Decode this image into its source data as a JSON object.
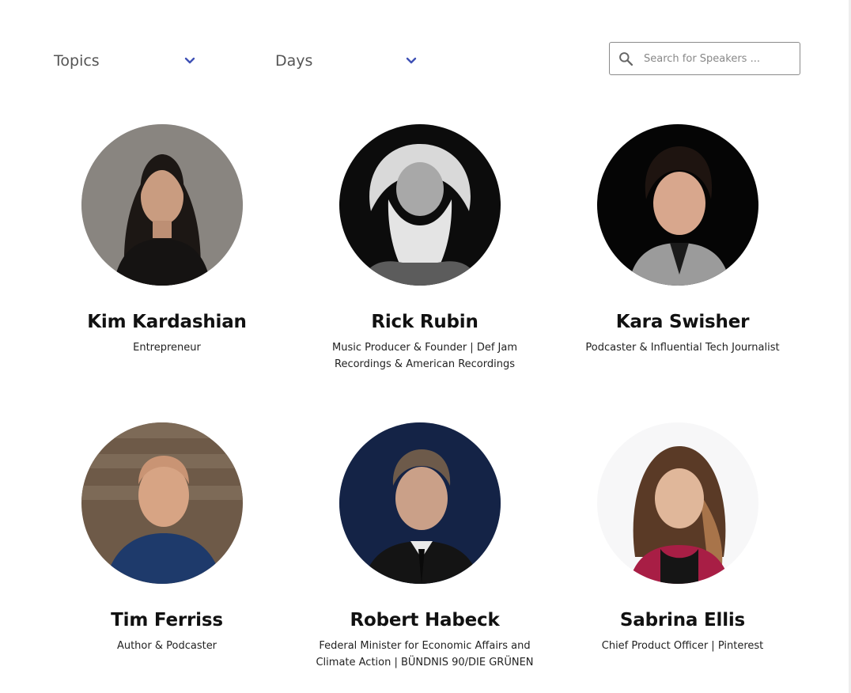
{
  "filters": {
    "topics_label": "Topics",
    "days_label": "Days"
  },
  "search": {
    "placeholder": "Search for Speakers ..."
  },
  "speakers": [
    {
      "name": "Kim Kardashian",
      "role": "Entrepreneur",
      "photo": "portrait-dark-hair-gray-bg"
    },
    {
      "name": "Rick Rubin",
      "role": "Music Producer & Founder | Def Jam Recordings & American Recordings",
      "photo": "portrait-white-beard-bw"
    },
    {
      "name": "Kara Swisher",
      "role": "Podcaster & Influential Tech Journalist",
      "photo": "portrait-short-hair-black-bg"
    },
    {
      "name": "Tim Ferriss",
      "role": "Author & Podcaster",
      "photo": "portrait-bald-blue-sweater"
    },
    {
      "name": "Robert Habeck",
      "role": "Federal Minister for Economic Affairs and Climate Action | BÜNDNIS 90/DIE GRÜNEN",
      "photo": "portrait-suit-dark-blue-bg"
    },
    {
      "name": "Sabrina Ellis",
      "role": "Chief Product Officer | Pinterest",
      "photo": "portrait-long-hair-white-bg"
    }
  ],
  "colors": {
    "accent": "#3f51b5",
    "text": "#111111",
    "muted": "#555555"
  }
}
